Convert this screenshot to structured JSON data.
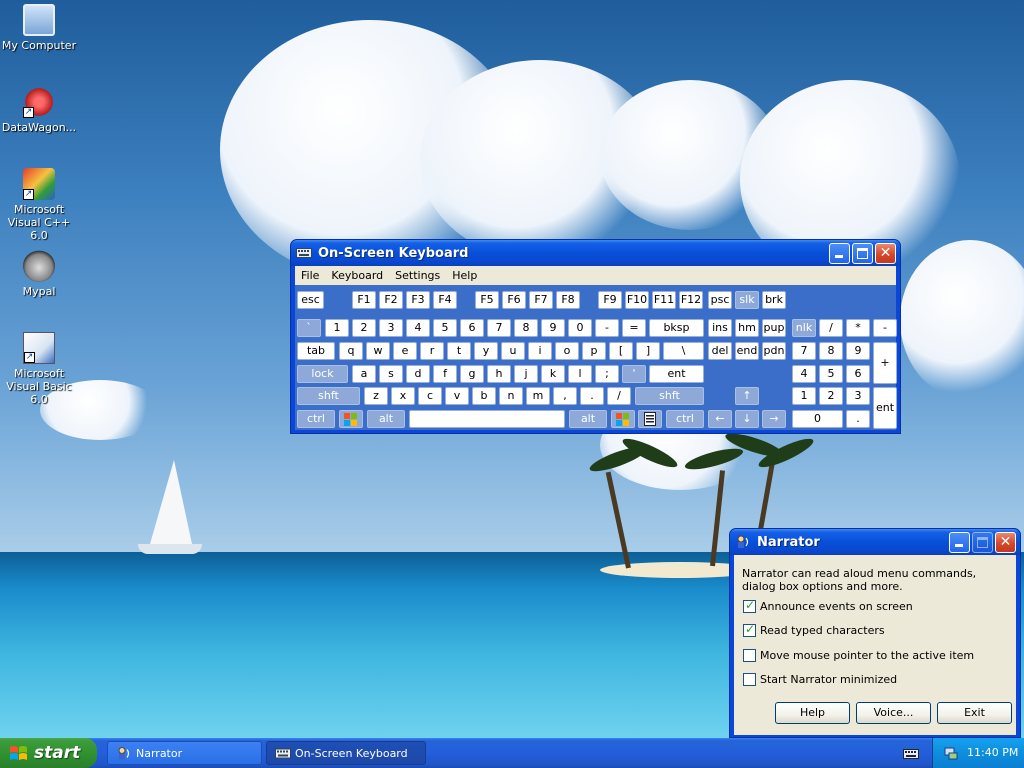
{
  "desktop": {
    "icons": [
      {
        "label": "My Computer"
      },
      {
        "label": "DataWagon..."
      },
      {
        "label": "Microsoft Visual C++ 6.0"
      },
      {
        "label": "Mypal"
      },
      {
        "label": "Microsoft Visual Basic 6.0"
      }
    ],
    "shortcut_arrow": "↗"
  },
  "osk": {
    "title": "On-Screen Keyboard",
    "menu": [
      "File",
      "Keyboard",
      "Settings",
      "Help"
    ],
    "keys": {
      "esc": "esc",
      "f1": "F1",
      "f2": "F2",
      "f3": "F3",
      "f4": "F4",
      "f5": "F5",
      "f6": "F6",
      "f7": "F7",
      "f8": "F8",
      "f9": "F9",
      "f10": "F10",
      "f11": "F11",
      "f12": "F12",
      "psc": "psc",
      "slk": "slk",
      "brk": "brk",
      "backtick": "`",
      "n1": "1",
      "n2": "2",
      "n3": "3",
      "n4": "4",
      "n5": "5",
      "n6": "6",
      "n7": "7",
      "n8": "8",
      "n9": "9",
      "n0": "0",
      "minus": "-",
      "equal": "=",
      "bksp": "bksp",
      "ins": "ins",
      "hm": "hm",
      "pup": "pup",
      "nlk": "nlk",
      "divide": "/",
      "multiply": "*",
      "np_minus": "-",
      "tab": "tab",
      "q": "q",
      "w": "w",
      "e": "e",
      "r": "r",
      "t": "t",
      "y": "y",
      "u": "u",
      "i": "i",
      "o": "o",
      "p": "p",
      "lbracket": "[",
      "rbracket": "]",
      "backslash": "\\",
      "del": "del",
      "end": "end",
      "pdn": "pdn",
      "np7": "7",
      "np8": "8",
      "np9": "9",
      "np_plus": "+",
      "lock": "lock",
      "a": "a",
      "s": "s",
      "d": "d",
      "f": "f",
      "g": "g",
      "h": "h",
      "j": "j",
      "k": "k",
      "l": "l",
      "semicolon": ";",
      "quote": "'",
      "ent": "ent",
      "np4": "4",
      "np5": "5",
      "np6": "6",
      "lshft": "shft",
      "z": "z",
      "x": "x",
      "c": "c",
      "v": "v",
      "b": "b",
      "n": "n",
      "m": "m",
      "comma": ",",
      "period": ".",
      "slash": "/",
      "rshft": "shft",
      "up": "↑",
      "np1": "1",
      "np2": "2",
      "np3": "3",
      "np_ent": "ent",
      "lctrl": "ctrl",
      "lalt": "alt",
      "ralt": "alt",
      "rctrl": "ctrl",
      "left": "←",
      "down": "↓",
      "right": "→",
      "np0": "0",
      "np_dot": "."
    }
  },
  "narrator": {
    "title": "Narrator",
    "description": "Narrator can read aloud menu commands, dialog box options and more.",
    "options": [
      {
        "label": "Announce events on screen",
        "checked": true
      },
      {
        "label": "Read typed characters",
        "checked": true
      },
      {
        "label": "Move mouse pointer to the active item",
        "checked": false
      },
      {
        "label": "Start Narrator minimized",
        "checked": false
      }
    ],
    "buttons": {
      "help": "Help",
      "voice": "Voice...",
      "exit": "Exit"
    }
  },
  "taskbar": {
    "start_label": "start",
    "items": [
      {
        "label": "Narrator",
        "active": false
      },
      {
        "label": "On-Screen Keyboard",
        "active": true
      }
    ],
    "clock": "11:40 PM"
  },
  "colors": {
    "title_active": "#0a47d8",
    "close_button": "#d6472b",
    "taskbar": "#245edb",
    "start_button": "#3c9c3c",
    "tray": "#0e8ee0"
  }
}
